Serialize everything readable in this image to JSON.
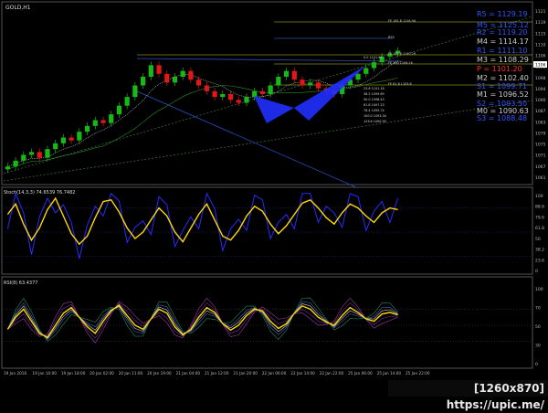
{
  "window": {
    "title": "GOLD,H1"
  },
  "main_chart": {
    "price_ticks": [
      "1121",
      "1119",
      "1115",
      "1110",
      "1106",
      "1102",
      "1098",
      "1094",
      "1090",
      "1087",
      "1083",
      "1079",
      "1075",
      "1071",
      "1067",
      "1061"
    ],
    "current_price": "1106",
    "pivot_labels": [
      {
        "text": "R5 = 1129.19",
        "color": "#3355ff"
      },
      {
        "text": "M5 = 1125.12",
        "color": "#3355ff"
      },
      {
        "text": "R2 = 1119.20",
        "color": "#3355ff"
      },
      {
        "text": "M4 = 1114.17",
        "color": "#cccccc"
      },
      {
        "text": "R1 = 1111.10",
        "color": "#3355ff"
      },
      {
        "text": "M3 = 1108.29",
        "color": "#cccccc"
      },
      {
        "text": "P = 1101.20",
        "color": "#ff3030"
      },
      {
        "text": "M2 = 1102.40",
        "color": "#cccccc"
      },
      {
        "text": "S1 = 1099.71",
        "color": "#3355ff"
      },
      {
        "text": "M1 = 1096.52",
        "color": "#cccccc"
      },
      {
        "text": "S2 = 1093.50",
        "color": "#3355ff"
      },
      {
        "text": "M0 = 1090.63",
        "color": "#cccccc"
      },
      {
        "text": "S3 = 1088.48",
        "color": "#3355ff"
      }
    ],
    "fib_labels": [
      "FE 161.8 1116.94",
      "R53",
      "FE 161.8 1110.29",
      "FE 100 1106.16",
      "FE 61.8 1103.6",
      "0.0 1101.94",
      "23.6 1101.18",
      "38.2 1099.69",
      "50.0 1098.43",
      "61.8 1097.23",
      "76.4 1095.74",
      "100.0 1093.34",
      "123.6 1090.95"
    ]
  },
  "stoch_panel": {
    "title": "Stoch(14,3,3) 74.6539 76.7482",
    "ticks": [
      "100",
      "88.6",
      "79.6",
      "61.8",
      "50",
      "38.2",
      "23.6",
      "0"
    ]
  },
  "rsi_panel": {
    "title": "RSI(8) 63.4377",
    "ticks": [
      "100",
      "70",
      "50",
      "30",
      "0"
    ]
  },
  "time_axis": [
    "19 Jan 2016",
    "19 Jan 10:00",
    "19 Jan 18:00",
    "20 Jan 02:00",
    "20 Jan 11:00",
    "20 Jan 19:00",
    "21 Jan 04:00",
    "21 Jan 12:00",
    "21 Jan 20:00",
    "22 Jan 06:00",
    "22 Jan 14:00",
    "22 Jan 22:00",
    "25 Jan 06:00",
    "25 Jan 14:00",
    "25 Jan 22:00"
  ],
  "watermark": "[1260x870] https://upic.me/",
  "colors": {
    "bull": "#18b818",
    "bear": "#e01818",
    "stoch_main": "#ffd800",
    "stoch_signal": "#2a2aff",
    "rsi": "#ffd800",
    "pattern": "#2030ff"
  },
  "chart_data": {
    "type": "line",
    "title": "GOLD,H1",
    "xlabel": "",
    "ylabel": "",
    "ylim": [
      1061,
      1121
    ],
    "series": [
      {
        "name": "GOLD,H1",
        "values": [
          1066,
          1068,
          1070,
          1071,
          1069,
          1072,
          1074,
          1076,
          1075,
          1078,
          1080,
          1082,
          1081,
          1084,
          1087,
          1090,
          1094,
          1097,
          1101,
          1098,
          1095,
          1097,
          1099,
          1096,
          1094,
          1092,
          1090,
          1091,
          1089,
          1088,
          1090,
          1092,
          1091,
          1094,
          1097,
          1099,
          1096,
          1094,
          1095,
          1093,
          1092,
          1091,
          1094,
          1096,
          1098,
          1100,
          1102,
          1104,
          1105,
          1106
        ]
      }
    ]
  }
}
